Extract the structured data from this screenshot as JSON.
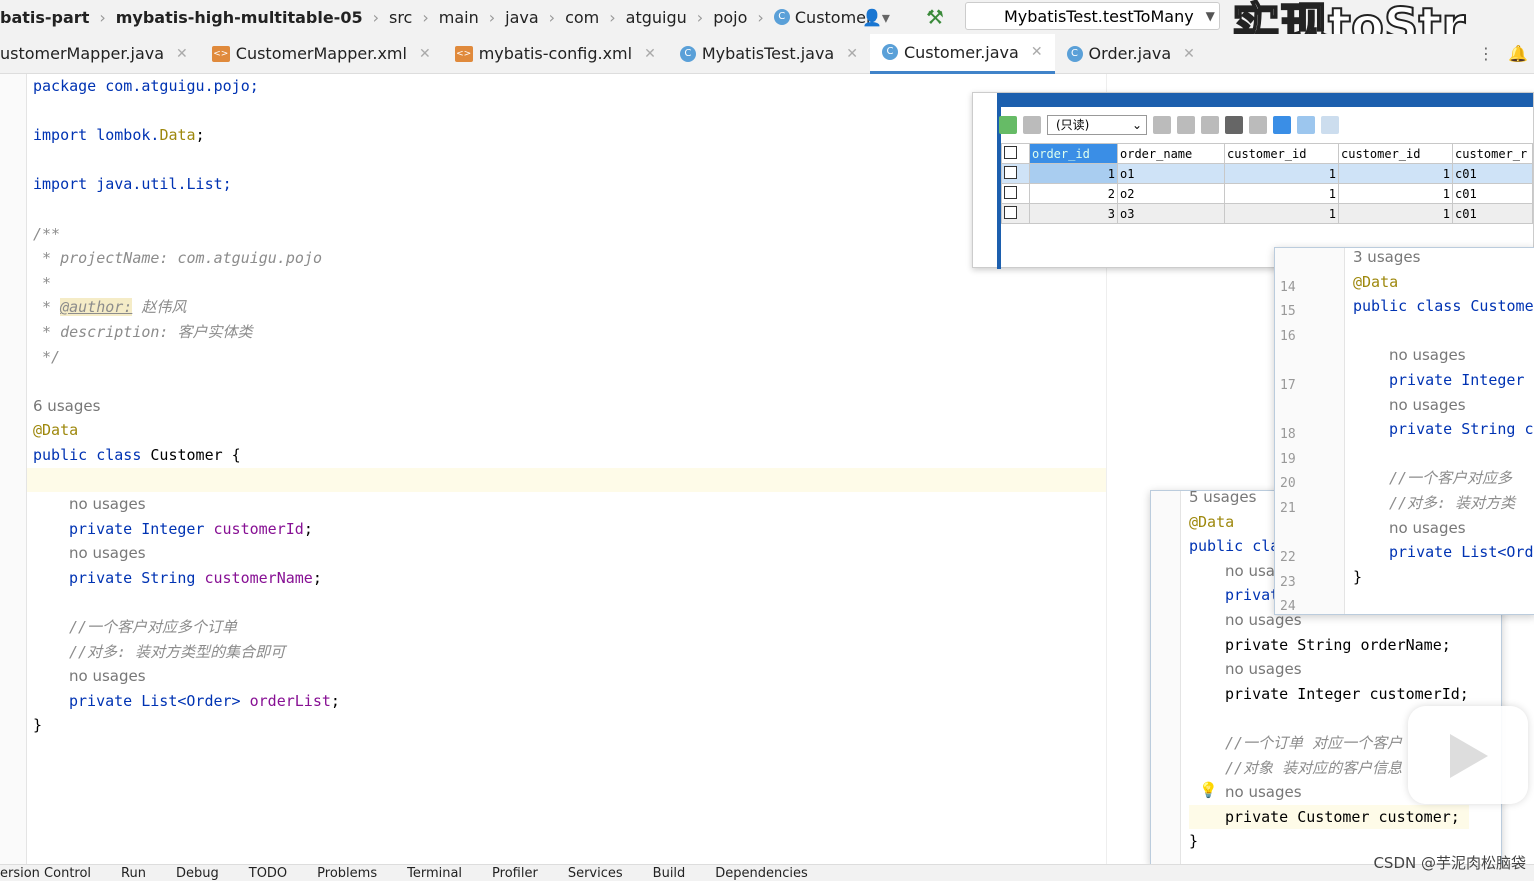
{
  "breadcrumb": [
    "batis-part",
    "mybatis-high-multitable-05",
    "src",
    "main",
    "java",
    "com",
    "atguigu",
    "pojo",
    "Customer"
  ],
  "run_config": "MybatisTest.testToMany",
  "video_caption": "实现toStr",
  "tabs": [
    {
      "label": "ustomerMapper.java",
      "icon": "java-class"
    },
    {
      "label": "CustomerMapper.xml",
      "icon": "xml"
    },
    {
      "label": "mybatis-config.xml",
      "icon": "xml"
    },
    {
      "label": "MybatisTest.java",
      "icon": "java-class"
    },
    {
      "label": "Customer.java",
      "icon": "java-class",
      "active": true
    },
    {
      "label": "Order.java",
      "icon": "java-class"
    }
  ],
  "code": {
    "package": "package com.atguigu.pojo;",
    "import1_pre": "import lombok.",
    "import1_cls": "Data",
    "import1_post": ";",
    "import2": "import java.util.List;",
    "doc": [
      "/**",
      " * projectName: com.atguigu.pojo",
      " *"
    ],
    "author_tag": "@author:",
    "author_name": " 赵伟风",
    "doc_desc": " * description: 客户实体类",
    "doc_end": " */",
    "usages": "6 usages",
    "annotation": "@Data",
    "class_kw": "public class ",
    "class_name": "Customer {",
    "no_usages": "no usages",
    "f1_type": "private Integer ",
    "f1_name": "customerId",
    "semi": ";",
    "f2_type": "private String ",
    "f2_name": "customerName",
    "c1": "//一个客户对应多个订单",
    "c2": "//对多: 装对方类型的集合即可",
    "f3_type": "private List<Order> ",
    "f3_name": "orderList",
    "close": "}"
  },
  "db_result": {
    "readonly": "(只读)",
    "columns": [
      "order_id",
      "order_name",
      "customer_id",
      "customer_id",
      "customer_r"
    ],
    "rows": [
      [
        "1",
        "o1",
        "1",
        "1",
        "c01"
      ],
      [
        "2",
        "o2",
        "1",
        "1",
        "c01"
      ],
      [
        "3",
        "o3",
        "1",
        "1",
        "c01"
      ]
    ]
  },
  "peek_customer": {
    "lines": [
      "",
      "14",
      "15",
      "16",
      "",
      "17",
      "",
      "18",
      "19",
      "20",
      "21",
      "",
      "22",
      "23",
      "24"
    ],
    "code": [
      "3 usages",
      "@Data",
      "public class Custome",
      "",
      "no usages",
      "private Integer",
      "no usages",
      "private String c",
      "",
      "//一个客户对应多",
      "//对多: 装对方类",
      "no usages",
      "private List<Ord",
      "}",
      ""
    ]
  },
  "peek_order": {
    "code": [
      "5 usages",
      "@Data",
      "public cla",
      "no usa",
      "privat",
      "no usages",
      "private String orderName;",
      "no usages",
      "private Integer customerId;",
      "",
      "//一个订单 对应一个客户",
      "//对象 装对应的客户信息",
      "no usages",
      "private Customer customer;",
      "}"
    ]
  },
  "bottom_tools": [
    "ersion Control",
    "Run",
    "Debug",
    "TODO",
    "Problems",
    "Terminal",
    "Profiler",
    "Services",
    "Build",
    "Dependencies"
  ],
  "watermark": "CSDN @芋泥肉松脑袋"
}
